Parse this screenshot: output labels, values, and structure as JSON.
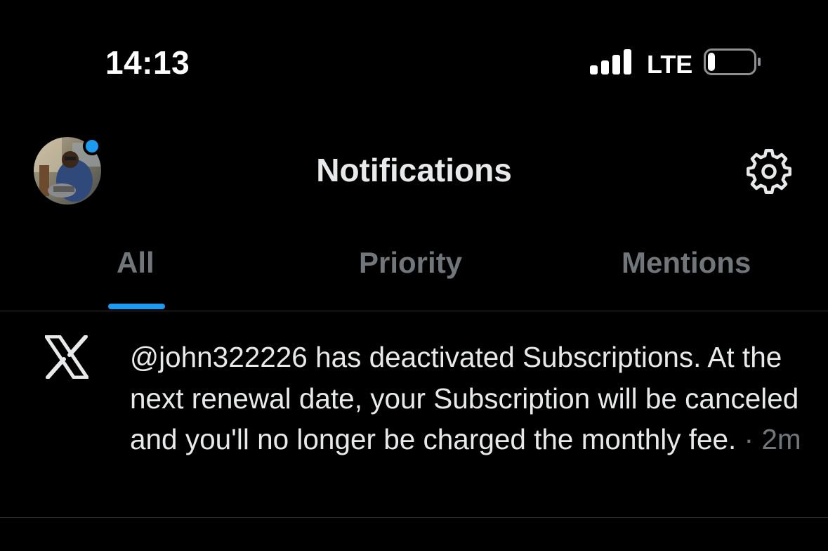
{
  "status_bar": {
    "time": "14:13",
    "network": "LTE",
    "signal_bars": 4,
    "battery_level": 0.15
  },
  "header": {
    "title": "Notifications",
    "has_unread_dot": true
  },
  "tabs": [
    {
      "label": "All",
      "active": true
    },
    {
      "label": "Priority",
      "active": false
    },
    {
      "label": "Mentions",
      "active": false
    }
  ],
  "notifications": [
    {
      "icon": "x-logo-icon",
      "text": "@john322226 has deactivated Subscriptions. At the next renewal date, your Subscription will be canceled and you'll no longer be charged the monthly fee.",
      "separator": " · ",
      "time": "2m"
    }
  ],
  "colors": {
    "background": "#000000",
    "text_primary": "#e7e9ea",
    "text_secondary": "#71767b",
    "accent": "#1d9bf0",
    "divider": "#2f3336"
  }
}
